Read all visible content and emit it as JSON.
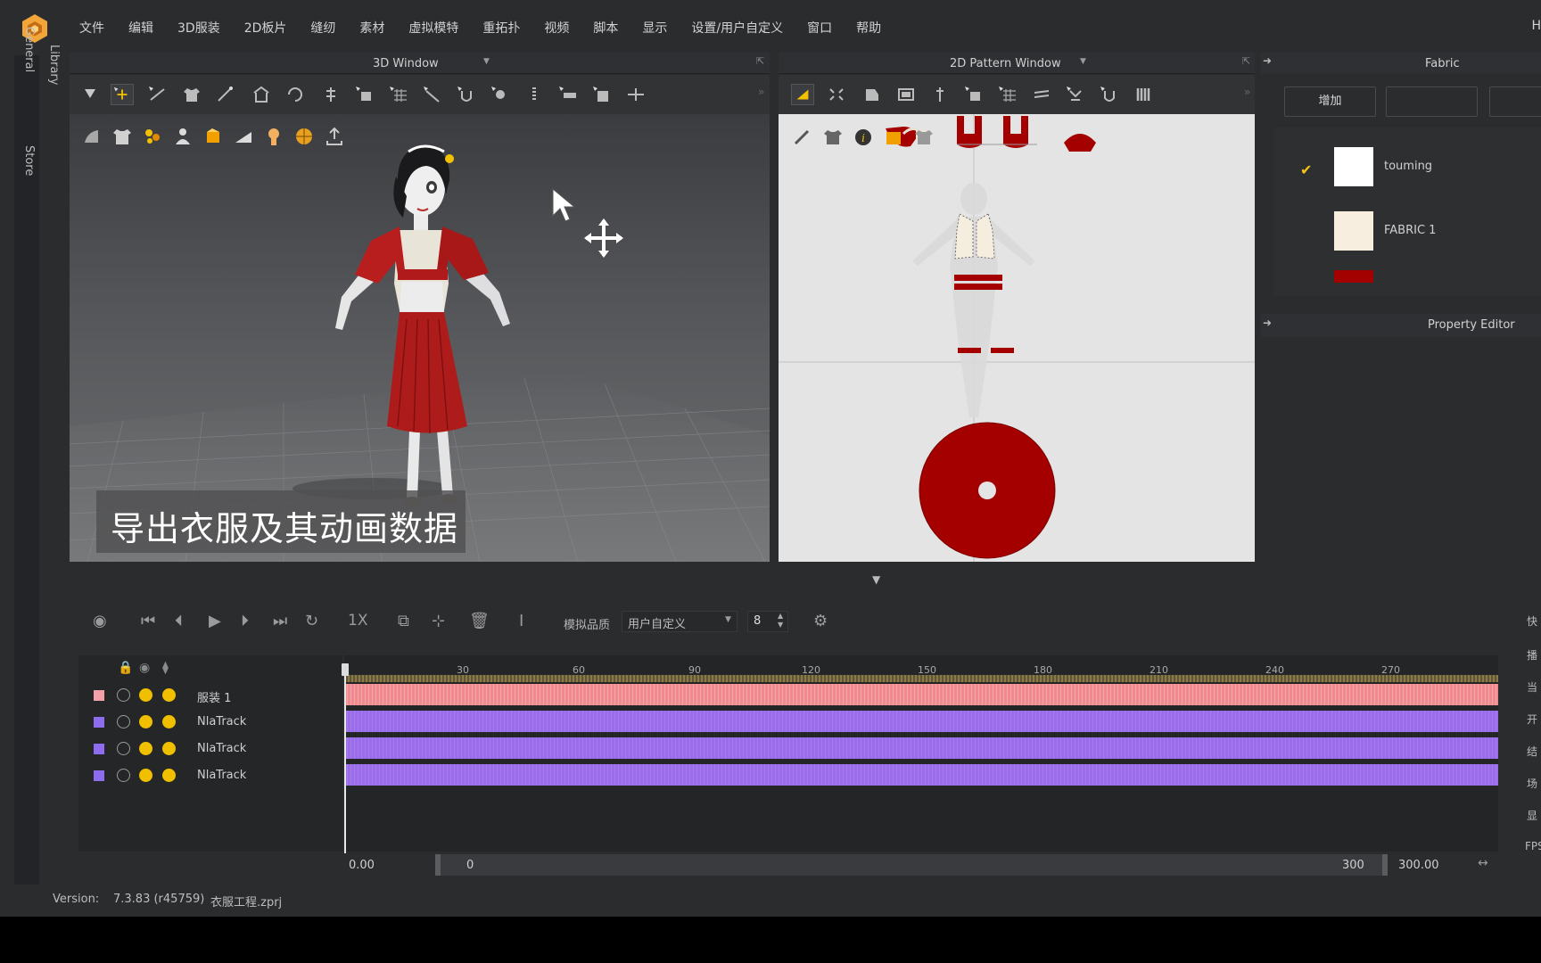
{
  "menu": {
    "items": [
      "文件",
      "编辑",
      "3D服装",
      "2D板片",
      "缝纫",
      "素材",
      "虚拟模特",
      "重拓扑",
      "视频",
      "脚本",
      "显示",
      "设置/用户自定义",
      "窗口",
      "帮助"
    ],
    "cut_item": "H"
  },
  "left_tabs": {
    "general": "General",
    "library": "Library",
    "store": "Store"
  },
  "window_3d": {
    "title": "3D Window",
    "subtitle": "导出衣服及其动画数据"
  },
  "window_2d": {
    "title": "2D Pattern Window"
  },
  "fabric_panel": {
    "title": "Fabric",
    "add_button": "增加",
    "items": [
      {
        "name": "touming",
        "color": "#ffffff",
        "selected": true
      },
      {
        "name": "FABRIC 1",
        "color": "#f8eedf",
        "selected": false
      },
      {
        "name": "",
        "color": "#a30000",
        "selected": false
      }
    ]
  },
  "property_editor": {
    "title": "Property Editor"
  },
  "animation": {
    "speed": "1X",
    "quality_label": "模拟品质",
    "quality_value": "用户自定义",
    "steps": "8"
  },
  "timeline": {
    "ruler_labels": [
      "30",
      "60",
      "90",
      "120",
      "150",
      "180",
      "210",
      "240",
      "270"
    ],
    "tracks": [
      {
        "name": "服装 1",
        "color": "#f4a0a8",
        "bar_color": "#f08a8e"
      },
      {
        "name": "NlaTrack",
        "color": "#8e6cf0",
        "bar_color": "#9a6cea"
      },
      {
        "name": "NlaTrack",
        "color": "#8e6cf0",
        "bar_color": "#9a6cea"
      },
      {
        "name": "NlaTrack",
        "color": "#8e6cf0",
        "bar_color": "#9a6cea"
      }
    ],
    "range_start": "0.00",
    "range_from": "0",
    "range_to": "300",
    "range_end": "300.00"
  },
  "side_labels": [
    "快",
    "播",
    "当",
    "开",
    "结",
    "场",
    "显",
    "FPS"
  ],
  "status": {
    "version_label": "Version:",
    "version_value": "7.3.83 (r45759)",
    "project_file": "衣服工程.zprj"
  }
}
